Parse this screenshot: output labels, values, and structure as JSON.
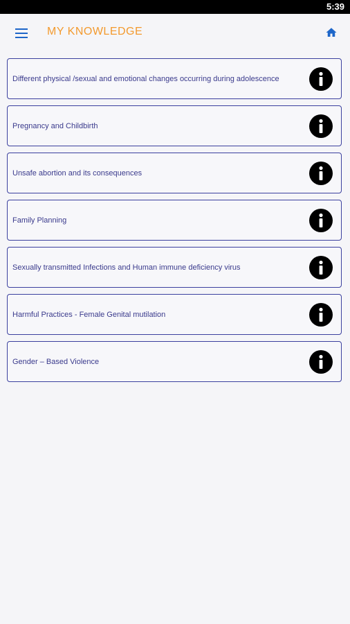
{
  "status_bar": {
    "time": "5:39"
  },
  "app_bar": {
    "title": "MY KNOWLEDGE",
    "menu_icon": "hamburger-menu-icon",
    "home_icon": "home-icon"
  },
  "colors": {
    "title": "#f39a2e",
    "accent": "#3a3f9e",
    "icon_blue": "#1e66c9",
    "text": "#3a3a8c",
    "background": "#f5f5f8",
    "status_bar": "#000000"
  },
  "topics": [
    {
      "label": "Different physical /sexual and emotional changes occurring during adolescence",
      "icon": "info-icon"
    },
    {
      "label": "Pregnancy and Childbirth",
      "icon": "info-icon"
    },
    {
      "label": "Unsafe abortion and its consequences",
      "icon": "info-icon"
    },
    {
      "label": "Family Planning",
      "icon": "info-icon"
    },
    {
      "label": "Sexually transmitted Infections and Human immune deficiency virus",
      "icon": "info-icon"
    },
    {
      "label": "Harmful Practices - Female Genital mutilation",
      "icon": "info-icon"
    },
    {
      "label": "Gender – Based Violence",
      "icon": "info-icon"
    }
  ]
}
